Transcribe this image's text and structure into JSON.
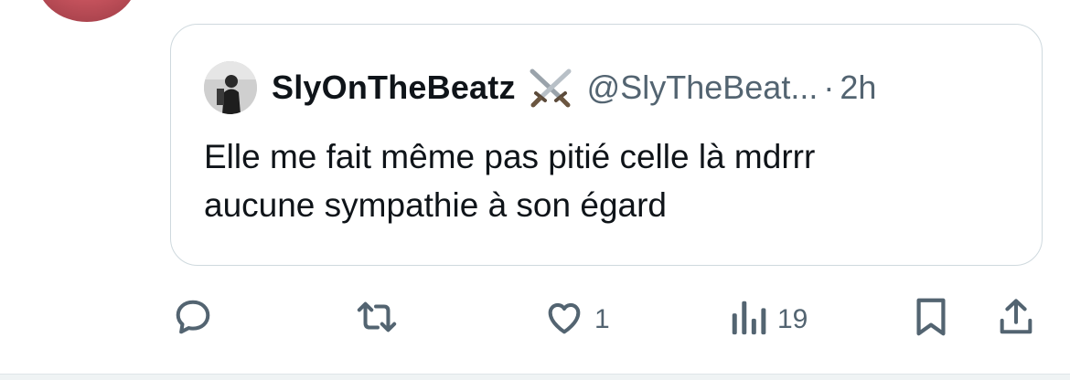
{
  "quoted_tweet": {
    "display_name": "SlyOnTheBeatz",
    "name_emoji": "crossed-swords-icon",
    "handle": "@SlyTheBeat...",
    "separator": "·",
    "time": "2h",
    "text_line1": "Elle me fait même pas pitié celle là mdrrr",
    "text_line2": "aucune sympathie à son égard"
  },
  "actions": {
    "reply": {
      "icon": "reply-icon"
    },
    "retweet": {
      "icon": "retweet-icon"
    },
    "like": {
      "icon": "heart-icon",
      "count": "1"
    },
    "views": {
      "icon": "views-chart-icon",
      "count": "19"
    },
    "bookmark": {
      "icon": "bookmark-icon"
    },
    "share": {
      "icon": "share-icon"
    }
  },
  "colors": {
    "text_primary": "#0f1419",
    "text_secondary": "#536471",
    "border": "#cfd9de"
  }
}
